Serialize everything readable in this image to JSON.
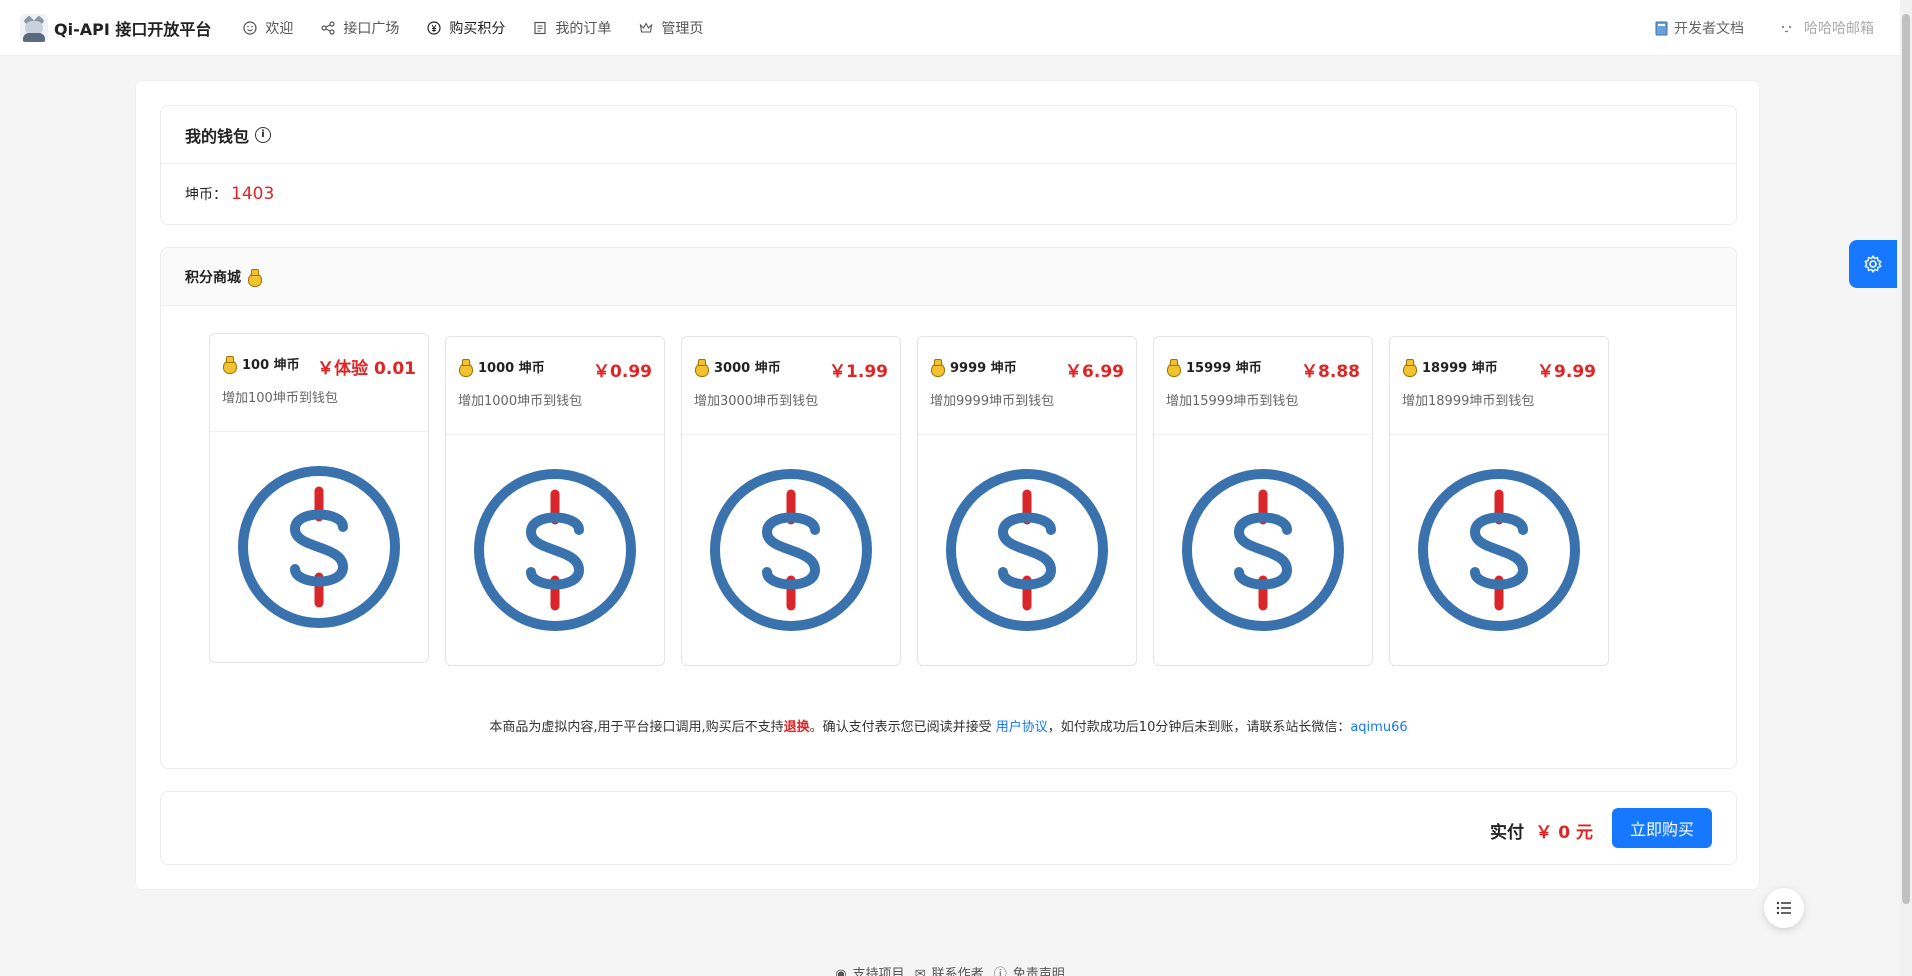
{
  "header": {
    "logo_text": "Qi-API 接口开放平台",
    "nav": [
      {
        "label": "欢迎",
        "icon": "smile-icon"
      },
      {
        "label": "接口广场",
        "icon": "share-icon"
      },
      {
        "label": "购买积分",
        "icon": "coin-icon",
        "active": true
      },
      {
        "label": "我的订单",
        "icon": "order-icon"
      },
      {
        "label": "管理页",
        "icon": "crown-icon"
      }
    ],
    "docs_label": "开发者文档",
    "user_label": "哈哈哈邮箱"
  },
  "wallet": {
    "title": "我的钱包",
    "coin_label": "坤币：",
    "coin_value": "1403"
  },
  "shop": {
    "title": "积分商城",
    "products": [
      {
        "name": "100 坤币",
        "price": "￥体验 0.01",
        "desc": "增加100坤币到钱包"
      },
      {
        "name": "1000 坤币",
        "price": "￥0.99",
        "desc": "增加1000坤币到钱包"
      },
      {
        "name": "3000 坤币",
        "price": "￥1.99",
        "desc": "增加3000坤币到钱包"
      },
      {
        "name": "9999 坤币",
        "price": "￥6.99",
        "desc": "增加9999坤币到钱包"
      },
      {
        "name": "15999 坤币",
        "price": "￥8.88",
        "desc": "增加15999坤币到钱包"
      },
      {
        "name": "18999 坤币",
        "price": "￥9.99",
        "desc": "增加18999坤币到钱包"
      }
    ],
    "notice": {
      "part1": "本商品为虚拟内容,用于平台接口调用,购买后不支持",
      "refund": "退换",
      "part2": "。确认支付表示您已阅读并接受 ",
      "agreement": "用户协议",
      "part3": "，如付款成功后10分钟后未到账，请联系站长微信：",
      "wechat": "aqimu66"
    }
  },
  "pay": {
    "label": "实付",
    "amount": "￥ 0 元",
    "button": "立即购买"
  },
  "footer": {
    "support": "支持项目",
    "contact": "联系作者",
    "disclaimer": "免责声明"
  },
  "colors": {
    "primary": "#1677ff",
    "price_red": "#e02424",
    "coin_blue": "#3a72ad",
    "coin_red": "#d9262b"
  }
}
